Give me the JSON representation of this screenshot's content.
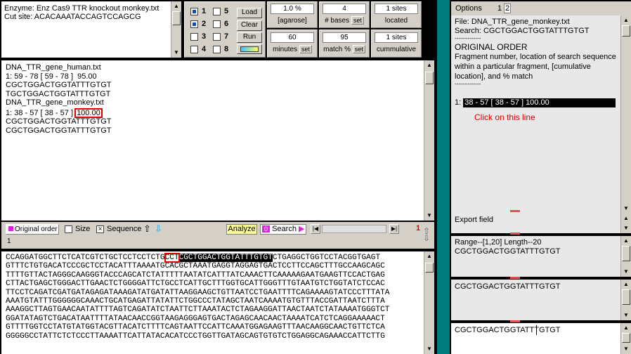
{
  "enzyme": {
    "enzyme_line": "Enzyme: Enz Cas9 TTR knockout monkey.txt",
    "cut_site_line": "Cut site: ACACAAATACCAGTCCAGCG"
  },
  "lanes": {
    "numbers": [
      "1",
      "5",
      "2",
      "6",
      "3",
      "7",
      "4",
      "8"
    ],
    "load": "Load",
    "clear": "Clear",
    "run": "Run"
  },
  "params": {
    "agarose_value": "1.0 %",
    "agarose_label": "[agarose]",
    "bases_value": "4",
    "bases_label": "# bases",
    "sites_value": "1 sites",
    "located_label": "located",
    "minutes_value": "60",
    "minutes_label": "minutes",
    "match_value": "95",
    "match_label": "match %",
    "sites2_value": "1 sites",
    "cumulative_label": "cummulative",
    "set": "set"
  },
  "results": {
    "lines": [
      "DNA_TTR_gene_human.txt",
      "",
      "1: 59 - 78 [ 59 - 78 ]  95.00",
      "CGCTGGACTGGTATTTGTGT",
      "TGCTGGACTGGTATTTGTGT",
      "",
      "",
      "DNA_TTR_gene_monkey.txt",
      "",
      "1: 38 - 57 [ 38 - 57 ] ",
      "CGCTGGACTGGTATTTGTGT",
      "CGCTGGACTGGTATTTGTGT"
    ],
    "highlight_value": "100.00"
  },
  "toolbar": {
    "original_order": "Original order",
    "size": "Size",
    "sequence": "Sequence",
    "analyze": "Analyze",
    "search_num": "0",
    "search": "Search",
    "counter": "1",
    "status": "1"
  },
  "sequence": {
    "line1_pre": "CCAGGATGGCTTCTCATCGTCTGCTCCTCCTCTG",
    "line1_pam": "CCT",
    "line1_sel": "CGCTGGACTGGTATTTGTGT",
    "line1_post": "CTGAGGCTGGTCCTACGGTGAGT",
    "lines": [
      "GTTTCTGTGACATCCCGCTCCTACATTTAAAATGCACGCTAAATGAGGTAGGAGTGACTCCTTCCAGCTTTGCCAAGCAGC",
      "TTTTGTTACTAGGGCAAGGGTACCCAGCATCTATTTTTAATATCATTTATCAAACTTCAAAAAGAATGAAGTTCCACTGAG",
      "CTTACTGAGCTGGGACTTGAACTCTGGGGATTCTGCCTCATTGCTTTGGTGCATTGGGTTTGTAATGTCTGGTATCTCCAC",
      "TTCCTCAGATCGATGATAGAGATAAAGATATGATATTAAGGAAGCTGTTAATCCTGAATTTTCAGAAAAGTATCCCTTTATA",
      "AAATGTATTTGGGGGGCAAACTGCATGAGATTATATTCTGGCCCTATAGCTAATCAAAATGTGTTTACCGATTAATCTTTA",
      "AAAGGCTTAGTGAACAATATTTTAGTCAGATATCTAATTCTTAAATACTCTAGAAGGATTAACTAATCTATAAAATGGGTCT",
      "GGATATAGTCTGACATAATTTTATAACAACCGGTAAGAGGGAGTGACTAGAGCAACAACTAAAATCATCTCAGGAAAAACT",
      "GTTTTGGTCCTATGTATGGTACGTTACATCTTTTCAGTAATTCCATTCAAATGGAGAAGTTTAACAAGGCAACTGTTCTCA",
      "GGGGGCCTATTCTCTCCCTTAAAATTCATTATACACATCCCTGGTTGATAGCAGTGTGTCTGGAGGCAGAAACCATTCTTG"
    ]
  },
  "right": {
    "tab_options": "Options",
    "tab1": "1",
    "tab2": "2",
    "file_line": "File:  DNA_TTR_gene_monkey.txt",
    "search_line": "Search:  CGCTGGACTGGTATTTGTGT",
    "dash1": "--------------",
    "order_title": "ORIGINAL ORDER",
    "desc": "Fragment number, location of search sequence within a particular fragment, [cumulative location], and % match",
    "dash2": "--------------",
    "result_prefix": "1: ",
    "result_sel": "38 - 57 [ 38 - 57 ]  100.00",
    "hint": "Click on this line",
    "export_field": "Export field",
    "range_line": "Range--[1,20]  Length--20",
    "range_seq": "CGCTGGACTGGTATTTGTGT",
    "seq_box": "CGCTGGACTGGTATTTGTGT",
    "edit_box": "CGCTGGACTGGTATTTGTGT"
  },
  "colors": {
    "teal_divider": "#007b7b",
    "hint_red": "#e00000",
    "selection": "#000000",
    "magenta": "#e020e0",
    "analyze_yellow": "#ffff99"
  }
}
